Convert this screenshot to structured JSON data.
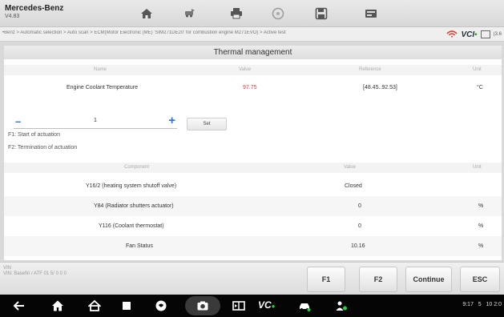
{
  "app": {
    "brand": "Mercedes-Benz",
    "version": "V4.83"
  },
  "toolbar": {
    "icons": [
      "home-icon",
      "vehicle-swap-icon",
      "print-icon",
      "help-icon",
      "save-icon",
      "data-logging-icon"
    ]
  },
  "breadcrumb": {
    "path": "•Benz > Automatic selection > Auto scan > ECM(Motor Electronic (ME) 'SIM271DE20' for combustion engine M271EVO) > Active test",
    "vci_label": "VCI",
    "battery": "(3.6"
  },
  "thermal": {
    "title": "Thermal management",
    "headers": {
      "name": "Name",
      "value": "Value",
      "reference": "Reference",
      "unit": "Unit"
    },
    "rows": [
      {
        "name": "Engine Coolant Temperature",
        "value": "97.75",
        "reference": "[48.45..92.53]",
        "unit": "°C"
      }
    ]
  },
  "actuation": {
    "value": "1",
    "set_label": "Set",
    "f1_note": "F1: Start of actuation",
    "f2_note": "F2: Termination of actuation"
  },
  "components": {
    "headers": {
      "name": "Component",
      "value": "Value",
      "unit": "Unit"
    },
    "rows": [
      {
        "name": "Y16/2 (heating system shutoff valve)",
        "value": "Closed",
        "unit": ""
      },
      {
        "name": "Y84 (Radiator shutters actuator)",
        "value": "0",
        "unit": "%"
      },
      {
        "name": "Y116 (Coolant thermostat)",
        "value": "0",
        "unit": "%"
      },
      {
        "name": "Fan Status",
        "value": "10.16",
        "unit": "%"
      }
    ]
  },
  "function_bar": {
    "info_line1": "VIN",
    "info_line2": "VIN: Basefiri / ATF 01 5/ 0 0 0",
    "buttons": [
      "F1",
      "F2",
      "Continue",
      "ESC"
    ]
  },
  "navbar": {
    "vci_label": "VC",
    "status_text": "9:17   5   10 2:0"
  },
  "colors": {
    "value_alert": "#e53935",
    "accent_blue": "#2a6fd1",
    "vci_green": "#2aa62a"
  }
}
